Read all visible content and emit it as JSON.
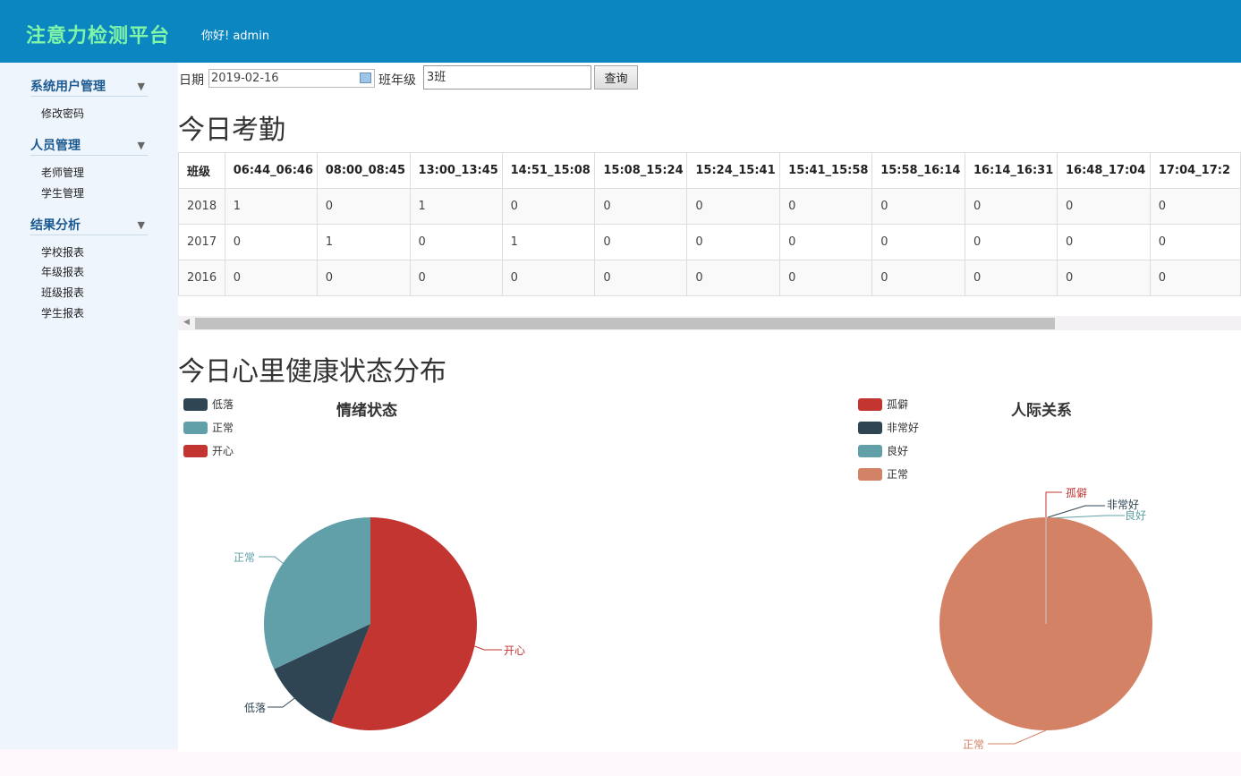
{
  "header": {
    "brand": "注意力检测平台",
    "greeting": "你好! admin"
  },
  "sidebar": {
    "groups": [
      {
        "title": "系统用户管理",
        "items": [
          "修改密码"
        ]
      },
      {
        "title": "人员管理",
        "items": [
          "老师管理",
          "学生管理"
        ]
      },
      {
        "title": "结果分析",
        "items": [
          "学校报表",
          "年级报表",
          "班级报表",
          "学生报表"
        ]
      }
    ]
  },
  "filters": {
    "date_label": "日期",
    "date_value": "2019-02-16",
    "class_label": "班年级",
    "class_value": "3班",
    "query_label": "查询"
  },
  "attendance": {
    "title": "今日考勤",
    "columns": [
      "班级",
      "06:44_06:46",
      "08:00_08:45",
      "13:00_13:45",
      "14:51_15:08",
      "15:08_15:24",
      "15:24_15:41",
      "15:41_15:58",
      "15:58_16:14",
      "16:14_16:31",
      "16:48_17:04",
      "17:04_17:2"
    ],
    "rows": [
      [
        "2018",
        "1",
        "0",
        "1",
        "0",
        "0",
        "0",
        "0",
        "0",
        "0",
        "0",
        "0"
      ],
      [
        "2017",
        "0",
        "1",
        "0",
        "1",
        "0",
        "0",
        "0",
        "0",
        "0",
        "0",
        "0"
      ],
      [
        "2016",
        "0",
        "0",
        "0",
        "0",
        "0",
        "0",
        "0",
        "0",
        "0",
        "0",
        "0"
      ]
    ]
  },
  "health": {
    "title": "今日心里健康状态分布"
  },
  "chart_data": [
    {
      "type": "pie",
      "title": "情绪状态",
      "legend": [
        "低落",
        "正常",
        "开心"
      ],
      "slices": [
        {
          "name": "开心",
          "value": 56,
          "color": "#c23531"
        },
        {
          "name": "低落",
          "value": 12,
          "color": "#2f4554"
        },
        {
          "name": "正常",
          "value": 32,
          "color": "#61a0a8"
        }
      ]
    },
    {
      "type": "pie",
      "title": "人际关系",
      "legend": [
        "孤僻",
        "非常好",
        "良好",
        "正常"
      ],
      "slices": [
        {
          "name": "孤僻",
          "value": 0,
          "color": "#c23531"
        },
        {
          "name": "非常好",
          "value": 0,
          "color": "#2f4554"
        },
        {
          "name": "良好",
          "value": 0,
          "color": "#61a0a8"
        },
        {
          "name": "正常",
          "value": 100,
          "color": "#d48265"
        }
      ]
    }
  ]
}
